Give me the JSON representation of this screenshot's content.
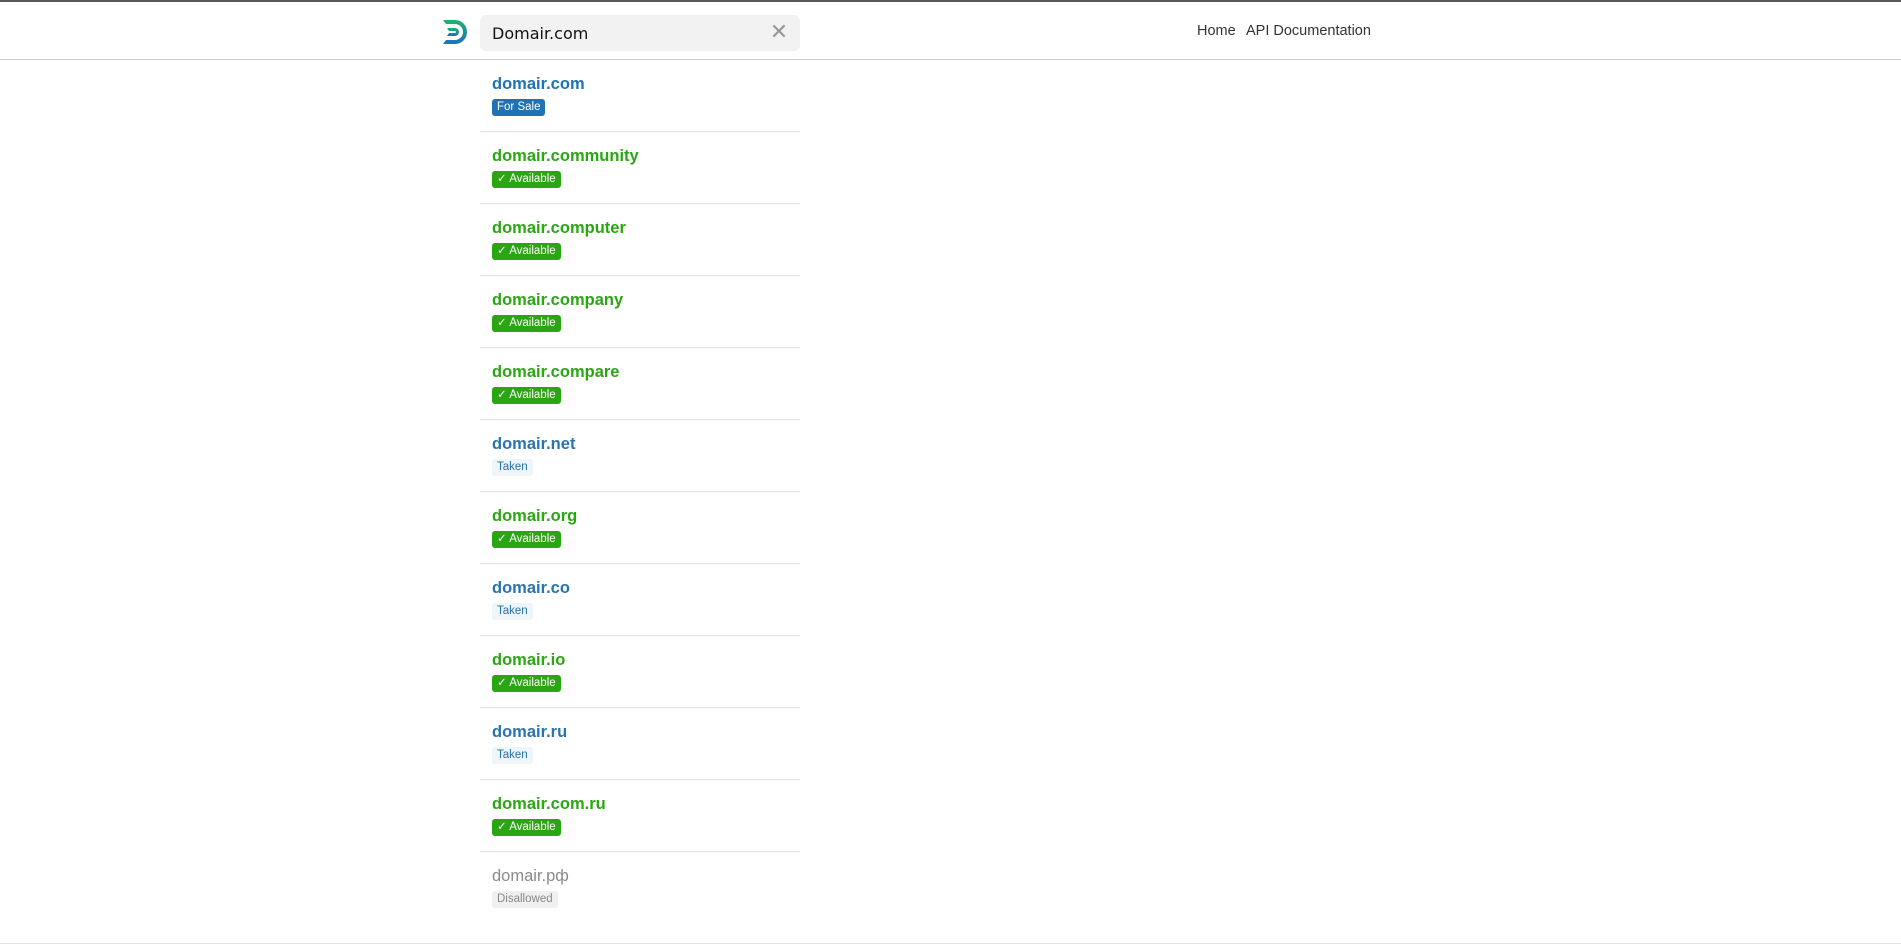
{
  "header": {
    "search_value": "Domair.com",
    "clear_icon": "close-icon",
    "nav": [
      {
        "label": "Home"
      },
      {
        "label": "API Documentation"
      }
    ]
  },
  "colors": {
    "for_sale": "#1f72b3",
    "available": "#2ba613",
    "taken": "#2a74ad",
    "disallowed": "#8a8a8a"
  },
  "results": [
    {
      "domain": "domair.com",
      "status": "sale",
      "badge": "For Sale"
    },
    {
      "domain": "domair.community",
      "status": "available",
      "badge": "✓ Available"
    },
    {
      "domain": "domair.computer",
      "status": "available",
      "badge": "✓ Available"
    },
    {
      "domain": "domair.company",
      "status": "available",
      "badge": "✓ Available"
    },
    {
      "domain": "domair.compare",
      "status": "available",
      "badge": "✓ Available"
    },
    {
      "domain": "domair.net",
      "status": "taken",
      "badge": "Taken"
    },
    {
      "domain": "domair.org",
      "status": "available",
      "badge": "✓ Available"
    },
    {
      "domain": "domair.co",
      "status": "taken",
      "badge": "Taken"
    },
    {
      "domain": "domair.io",
      "status": "available",
      "badge": "✓ Available"
    },
    {
      "domain": "domair.ru",
      "status": "taken",
      "badge": "Taken"
    },
    {
      "domain": "domair.com.ru",
      "status": "available",
      "badge": "✓ Available"
    },
    {
      "domain": "domair.рф",
      "status": "disallowed",
      "badge": "Disallowed"
    }
  ]
}
